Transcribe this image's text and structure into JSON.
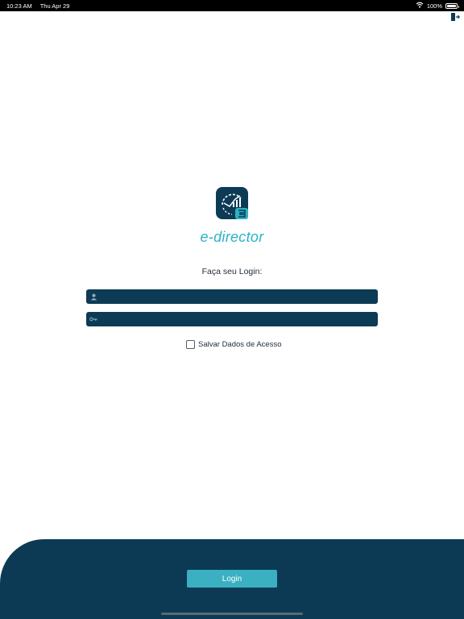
{
  "status_bar": {
    "time": "10:23 AM",
    "date": "Thu Apr 29",
    "battery": "100%",
    "battery_level": 1.0,
    "icons": [
      "wifi-icon",
      "battery-icon"
    ]
  },
  "header": {
    "logout_icon": "logout-icon"
  },
  "brand": {
    "app_name": "e-director",
    "logo_icon": "e-director-logo",
    "colors": {
      "primary": "#0c3a55",
      "accent": "#2ab3c4",
      "button": "#3ab0c1"
    }
  },
  "login": {
    "heading": "Faça seu Login:",
    "username": {
      "value": "",
      "placeholder": "",
      "icon": "user-icon"
    },
    "password": {
      "value": "",
      "placeholder": "",
      "icon": "key-icon"
    },
    "remember_label": "Salvar Dados de Acesso",
    "remember_checked": false,
    "submit_label": "Login"
  }
}
